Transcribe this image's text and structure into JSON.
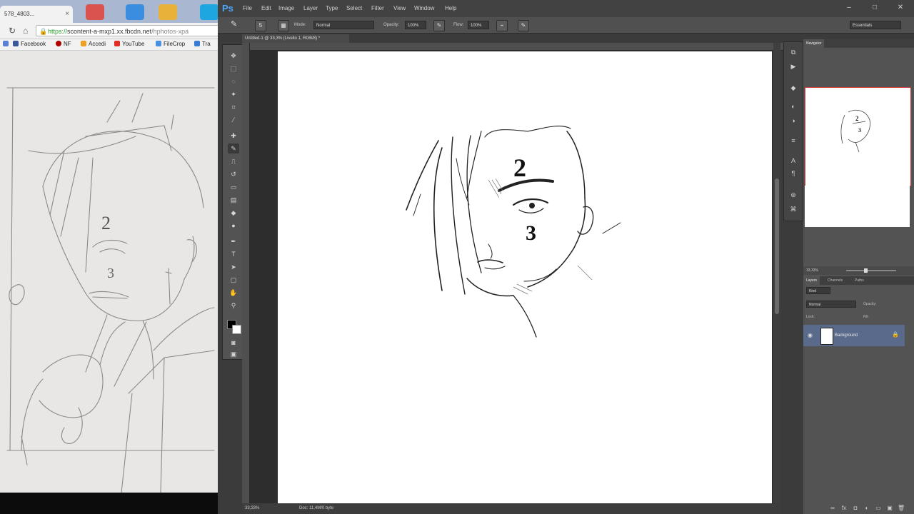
{
  "browser": {
    "tab_title": "578_4803...",
    "tab_close": "×",
    "url_prefix": "https://",
    "url_host": "scontent-a-mxp1.xx.fbcdn.net",
    "url_path": "/hphotos-xpa",
    "bookmarks": [
      "Facebook",
      "NF",
      "Accedi",
      "YouTube",
      "FileCrop",
      "Tra"
    ],
    "sketch_numbers": [
      "2",
      "3"
    ]
  },
  "photoshop": {
    "logo": "Ps",
    "menu": [
      "File",
      "Edit",
      "Image",
      "Layer",
      "Type",
      "Select",
      "Filter",
      "View",
      "Window",
      "Help"
    ],
    "window_controls": [
      "–",
      "□",
      "✕"
    ],
    "options": {
      "mode_label": "Mode:",
      "mode_value": "Normal",
      "opacity_label": "Opacity:",
      "opacity_value": "100%",
      "flow_label": "Flow:",
      "flow_value": "100%",
      "brush_size": "5",
      "workspace": "Essentials"
    },
    "document_tab": "Untitled-1 @ 33,3% (Livello 1, RGB/8) *",
    "zoom": "33,33%",
    "doc_info": "Doc: 11,4M/0 byte",
    "canvas_numbers": [
      "2",
      "3"
    ],
    "panels": {
      "navigator_tab": "Navigator",
      "navigator_zoom": "33,33%",
      "layers_tabs": [
        "Layers",
        "Channels",
        "Paths"
      ],
      "kind_label": "Kind",
      "blend_mode": "Normal",
      "opacity_label": "Opacity:",
      "lock_label": "Lock:",
      "fill_label": "Fill:",
      "layer_name": "Background"
    }
  },
  "colors": {
    "ps_bg": "#3b3b3b",
    "ps_panel": "#535353",
    "ps_accent": "#4ea6ff",
    "layer_selected": "#596a8a",
    "nav_frame": "#d43c3c"
  }
}
